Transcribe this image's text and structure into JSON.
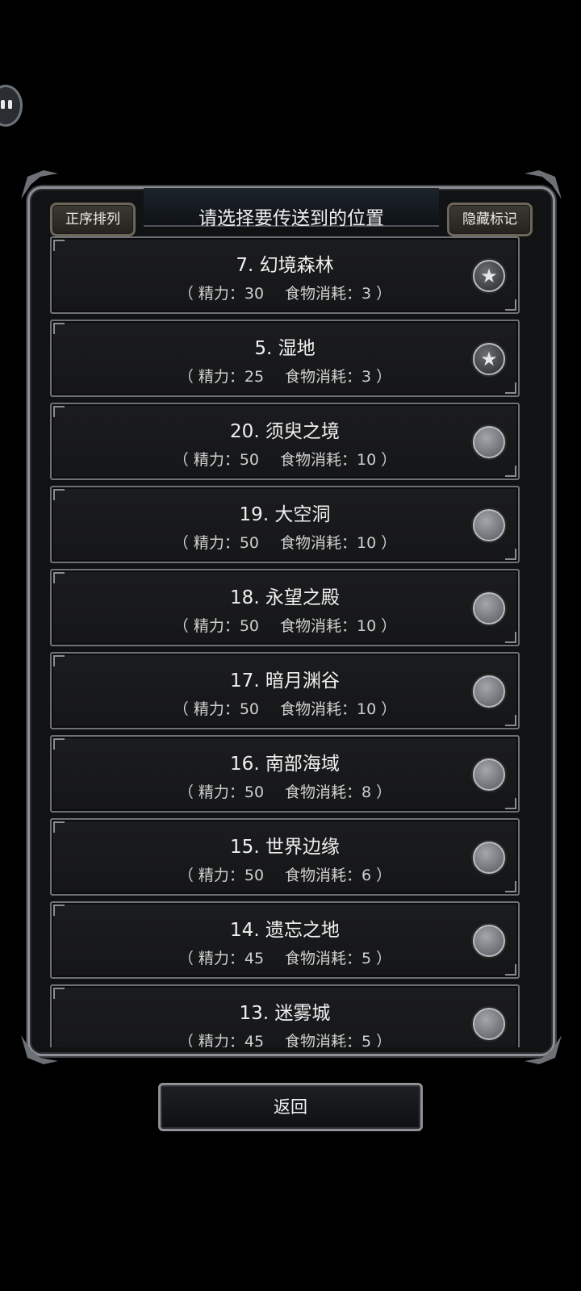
{
  "header": {
    "sort_label": "正序排列",
    "title": "请选择要传送到的位置",
    "hide_label": "隐藏标记"
  },
  "locations": [
    {
      "name": "7. 幻境森林",
      "energy": "（ 精力：30",
      "food": "食物消耗：3 ）",
      "marked": true
    },
    {
      "name": "5. 湿地",
      "energy": "（ 精力：25",
      "food": "食物消耗：3 ）",
      "marked": true
    },
    {
      "name": "20. 须臾之境",
      "energy": "（ 精力：50",
      "food": "食物消耗：10 ）",
      "marked": false
    },
    {
      "name": "19. 大空洞",
      "energy": "（ 精力：50",
      "food": "食物消耗：10 ）",
      "marked": false
    },
    {
      "name": "18. 永望之殿",
      "energy": "（ 精力：50",
      "food": "食物消耗：10 ）",
      "marked": false
    },
    {
      "name": "17. 暗月渊谷",
      "energy": "（ 精力：50",
      "food": "食物消耗：10 ）",
      "marked": false
    },
    {
      "name": "16. 南部海域",
      "energy": "（ 精力：50",
      "food": "食物消耗：8 ）",
      "marked": false
    },
    {
      "name": "15. 世界边缘",
      "energy": "（ 精力：50",
      "food": "食物消耗：6 ）",
      "marked": false
    },
    {
      "name": "14. 遗忘之地",
      "energy": "（ 精力：45",
      "food": "食物消耗：5 ）",
      "marked": false
    },
    {
      "name": "13. 迷雾城",
      "energy": "（ 精力：45",
      "food": "食物消耗：5 ）",
      "marked": false
    }
  ],
  "footer": {
    "back_label": "返回"
  },
  "icons": {
    "marked": "star-badge-icon",
    "unmarked": "empty-badge-icon"
  }
}
